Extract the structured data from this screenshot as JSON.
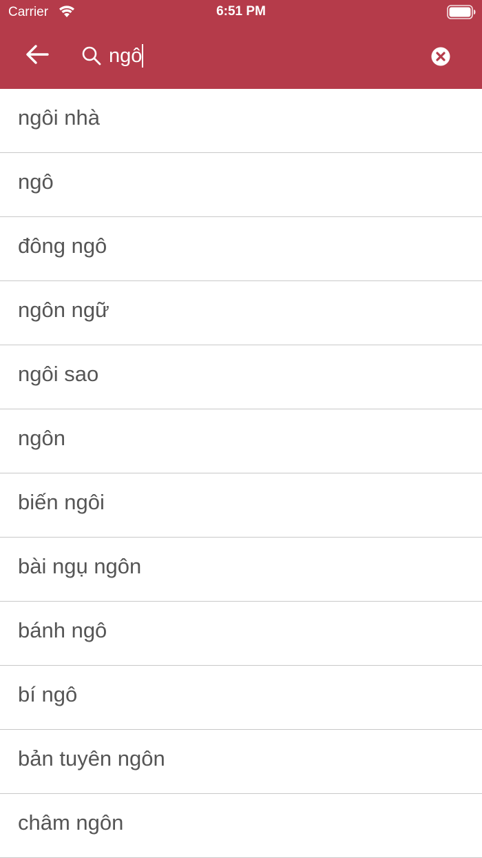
{
  "status_bar": {
    "carrier": "Carrier",
    "time": "6:51 PM"
  },
  "search": {
    "value": "ngô",
    "back_icon": "arrow-left-icon",
    "search_icon": "magnifier-icon",
    "clear_icon": "clear-circle-x-icon"
  },
  "colors": {
    "header_bg": "#b53b4a",
    "result_text": "#555555",
    "divider": "#c8c8c8"
  },
  "results": [
    "ngôi nhà",
    "ngô",
    "đông ngô",
    "ngôn ngữ",
    "ngôi sao",
    "ngôn",
    "biến ngôi",
    "bài ngụ ngôn",
    "bánh ngô",
    "bí ngô",
    "bản tuyên ngôn",
    "châm ngôn"
  ]
}
